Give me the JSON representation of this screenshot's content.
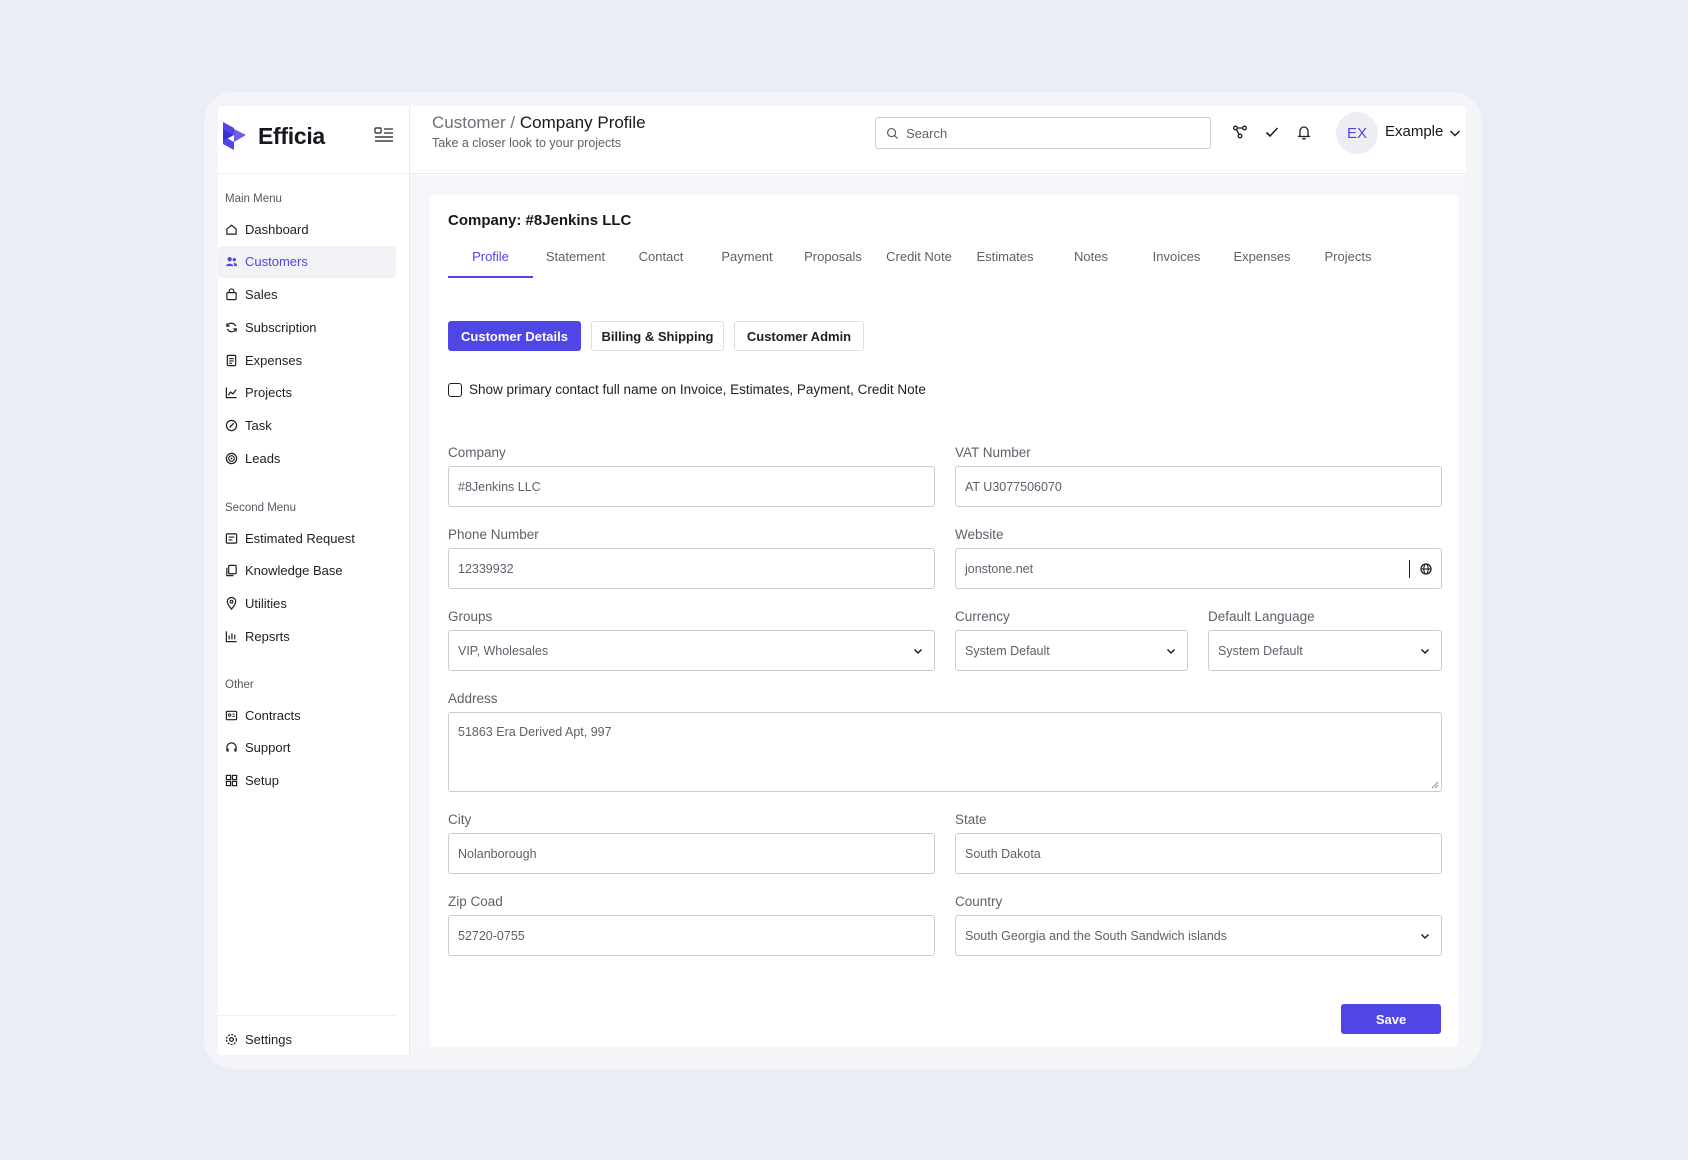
{
  "brand": {
    "name": "Efficia",
    "color": "#4f46e5"
  },
  "sidebar": {
    "main_menu_title": "Main Menu",
    "main_menu": [
      {
        "label": "Dashboard",
        "icon": "home-icon"
      },
      {
        "label": "Customers",
        "icon": "users-icon",
        "active": true
      },
      {
        "label": "Sales",
        "icon": "shopping-bag-icon"
      },
      {
        "label": "Subscription",
        "icon": "refresh-icon"
      },
      {
        "label": "Expenses",
        "icon": "receipt-icon"
      },
      {
        "label": "Projects",
        "icon": "chart-line-icon"
      },
      {
        "label": "Task",
        "icon": "edit-icon"
      },
      {
        "label": "Leads",
        "icon": "target-icon"
      }
    ],
    "second_menu_title": "Second Menu",
    "second_menu": [
      {
        "label": "Estimated Request",
        "icon": "form-icon"
      },
      {
        "label": "Knowledge Base",
        "icon": "copy-icon"
      },
      {
        "label": "Utilities",
        "icon": "pin-icon"
      },
      {
        "label": "Repsrts",
        "icon": "bar-chart-icon"
      }
    ],
    "other_title": "Other",
    "other_menu": [
      {
        "label": "Contracts",
        "icon": "id-card-icon"
      },
      {
        "label": "Support",
        "icon": "headset-icon"
      },
      {
        "label": "Setup",
        "icon": "grid-icon"
      }
    ],
    "settings_label": "Settings"
  },
  "header": {
    "breadcrumb_parent": "Customer /",
    "breadcrumb_current": "Company Profile",
    "subtitle": "Take a closer look to your projects",
    "search_placeholder": "Search",
    "avatar_initials": "EX",
    "user_name": "Example"
  },
  "company": {
    "title": "Company: #8Jenkins LLC",
    "tabs": [
      "Profile",
      "Statement",
      "Contact",
      "Payment",
      "Proposals",
      "Credit Note",
      "Estimates",
      "Notes",
      "Invoices",
      "Expenses",
      "Projects"
    ],
    "active_tab": "Profile",
    "sections": [
      "Customer Details",
      "Billing & Shipping",
      "Customer Admin"
    ],
    "active_section": "Customer Details",
    "checkbox_label": "Show primary contact full name on Invoice, Estimates, Payment, Credit Note",
    "checkbox_checked": false
  },
  "form": {
    "company": {
      "label": "Company",
      "value": "#8Jenkins LLC"
    },
    "vat": {
      "label": "VAT Number",
      "value": "AT U3077506070"
    },
    "phone": {
      "label": "Phone Number",
      "value": "12339932"
    },
    "website": {
      "label": "Website",
      "value": "jonstone.net"
    },
    "groups": {
      "label": "Groups",
      "value": "VIP, Wholesales"
    },
    "currency": {
      "label": "Currency",
      "value": "System Default"
    },
    "language": {
      "label": "Default Language",
      "value": "System Default"
    },
    "address": {
      "label": "Address",
      "value": "51863 Era Derived Apt, 997"
    },
    "city": {
      "label": "City",
      "value": "Nolanborough"
    },
    "state": {
      "label": "State",
      "value": "South Dakota"
    },
    "zip": {
      "label": "Zip Coad",
      "value": "52720-0755"
    },
    "country": {
      "label": "Country",
      "value": "South Georgia and the South Sandwich islands"
    },
    "save_label": "Save"
  }
}
